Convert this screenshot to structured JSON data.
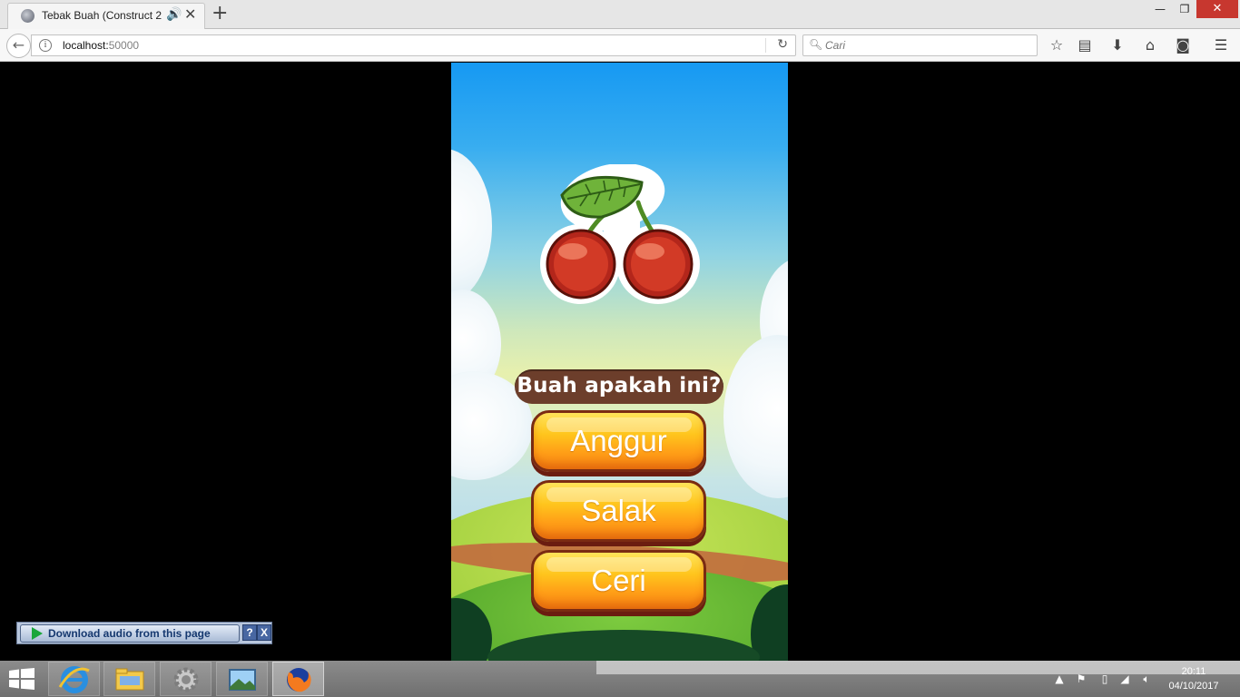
{
  "browser": {
    "tab_title": "Tebak Buah (Construct 2",
    "url_host": "localhost:",
    "url_port": "50000",
    "search_placeholder": "Cari"
  },
  "game": {
    "fruit_icon": "cherry-icon",
    "question": "Buah apakah ini?",
    "answers": [
      "Anggur",
      "Salak",
      "Ceri"
    ],
    "colors": {
      "sky_top": "#1699f3",
      "question_pill": "#6c3e2b",
      "button_top": "#ffe45a",
      "button_bottom": "#f47f13",
      "button_border": "#7a2b12"
    }
  },
  "download_bar": {
    "label": "Download audio from this page",
    "help": "?",
    "close": "X"
  },
  "taskbar": {
    "time": "20:11",
    "date": "04/10/2017"
  }
}
